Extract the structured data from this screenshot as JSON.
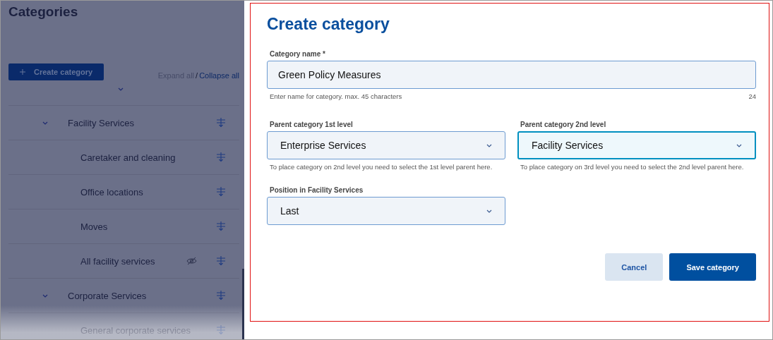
{
  "page": {
    "title": "Categories",
    "create_button": "Create category",
    "expand_all": "Expand all",
    "separator": "/",
    "collapse_all": "Collapse all"
  },
  "tree": [
    {
      "label": "Facility Services",
      "expanded": true,
      "hidden": false,
      "children": [
        {
          "label": "Caretaker and cleaning",
          "hidden": false
        },
        {
          "label": "Office locations",
          "hidden": false
        },
        {
          "label": "Moves",
          "hidden": false
        },
        {
          "label": "All facility services",
          "hidden": true
        }
      ]
    },
    {
      "label": "Corporate Services",
      "expanded": true,
      "hidden": false,
      "children": [
        {
          "label": "General corporate services",
          "hidden": false
        }
      ]
    }
  ],
  "dialog": {
    "title": "Create category",
    "name_field": {
      "label": "Category name *",
      "value": "Green Policy Measures",
      "hint": "Enter name for category. max. 45 characters",
      "count": "24"
    },
    "selects": [
      {
        "label": "Parent category 1st level",
        "value": "Enterprise Services",
        "hint": "To place category on 2nd level you need to select the 1st level parent here.",
        "focused": false
      },
      {
        "label": "Parent category 2nd level",
        "value": "Facility Services",
        "hint": "To place category on 3rd level you need to select the 2nd level parent here.",
        "focused": true
      },
      {
        "label": "Position in Facility Services",
        "value": "Last",
        "focused": false
      }
    ],
    "buttons": [
      {
        "label": "Cancel",
        "kind": "secondary"
      },
      {
        "label": "Save category",
        "kind": "primary"
      }
    ]
  }
}
